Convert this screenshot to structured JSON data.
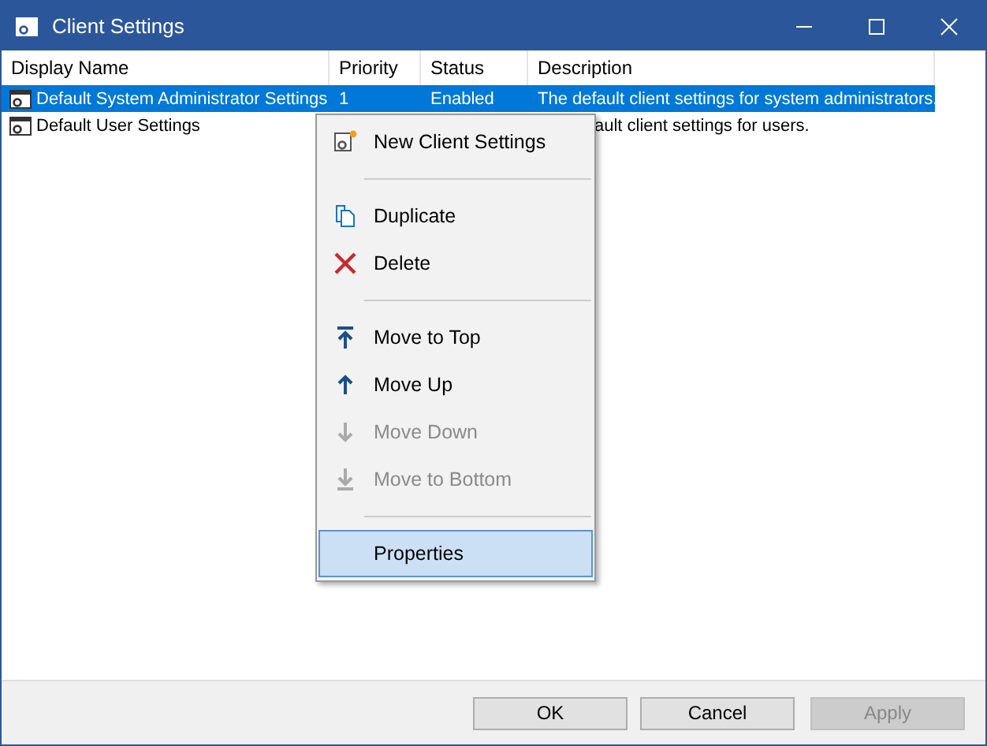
{
  "window": {
    "title": "Client Settings"
  },
  "table": {
    "columns": [
      "Display Name",
      "Priority",
      "Status",
      "Description"
    ],
    "rows": [
      {
        "selected": true,
        "cells": [
          "Default System Administrator Settings",
          "1",
          "Enabled",
          "The default client settings for system administrators."
        ]
      },
      {
        "selected": false,
        "cells": [
          "Default User Settings",
          "",
          "",
          "ault client settings for users."
        ]
      }
    ]
  },
  "context_menu": [
    {
      "kind": "item",
      "label": "New Client Settings",
      "disabled": false,
      "selected": false
    },
    {
      "kind": "separator"
    },
    {
      "kind": "item",
      "label": "Duplicate",
      "disabled": false,
      "selected": false
    },
    {
      "kind": "item",
      "label": "Delete",
      "disabled": false,
      "selected": false
    },
    {
      "kind": "separator"
    },
    {
      "kind": "item",
      "label": "Move to Top",
      "disabled": false,
      "selected": false
    },
    {
      "kind": "item",
      "label": "Move Up",
      "disabled": false,
      "selected": false
    },
    {
      "kind": "item",
      "label": "Move Down",
      "disabled": true,
      "selected": false
    },
    {
      "kind": "item",
      "label": "Move to Bottom",
      "disabled": true,
      "selected": false
    },
    {
      "kind": "separator"
    },
    {
      "kind": "item",
      "label": "Properties",
      "disabled": false,
      "selected": true
    }
  ],
  "buttons": [
    {
      "label": "OK",
      "disabled": false
    },
    {
      "label": "Cancel",
      "disabled": false
    },
    {
      "label": "Apply",
      "disabled": true
    }
  ]
}
